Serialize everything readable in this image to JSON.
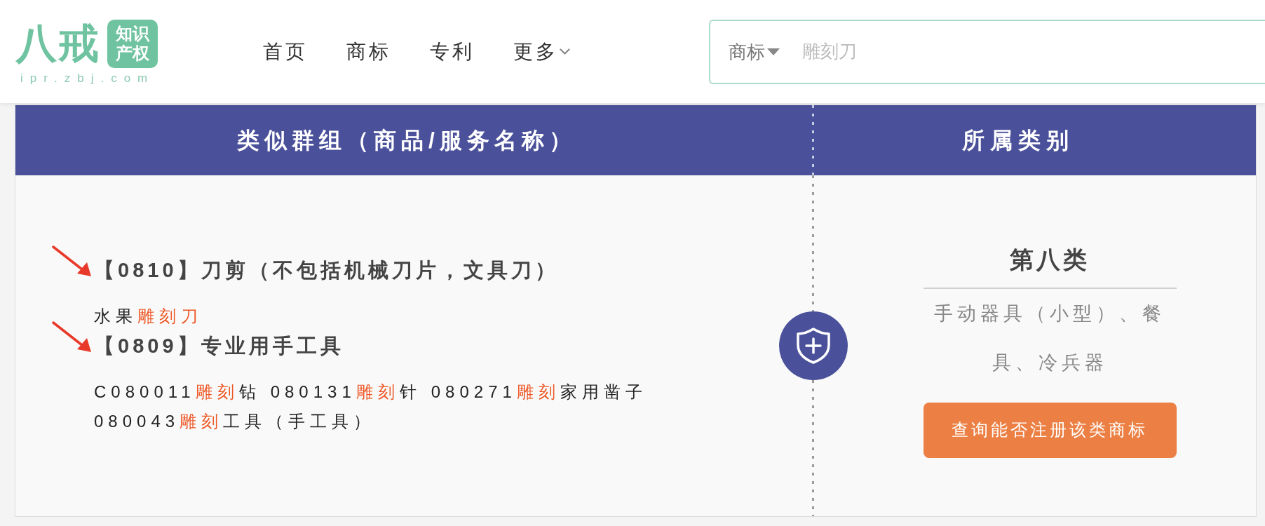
{
  "header": {
    "logo": {
      "name": "八戒",
      "badge": "知识产权",
      "domain": "ipr.zbj.com"
    },
    "nav": [
      {
        "label": "首页",
        "kind": "link"
      },
      {
        "label": "商标",
        "kind": "link"
      },
      {
        "label": "专利",
        "kind": "link"
      },
      {
        "label": "更多",
        "kind": "dropdown"
      }
    ],
    "search": {
      "category": "商标",
      "placeholder": "雕刻刀"
    }
  },
  "table": {
    "columns": [
      "类似群组（商品/服务名称）",
      "所属类别"
    ],
    "groups": [
      {
        "title": "【0810】刀剪（不包括机械刀片，文具刀）",
        "annotated": true,
        "items": [
          {
            "parts": [
              {
                "text": "水果",
                "highlight": false
              },
              {
                "text": "雕刻刀",
                "highlight": true
              }
            ]
          }
        ]
      },
      {
        "title": "【0809】专业用手工具",
        "annotated": true,
        "items": [
          {
            "parts": [
              {
                "text": "C080011",
                "highlight": false
              },
              {
                "text": "雕刻",
                "highlight": true
              },
              {
                "text": "钻",
                "highlight": false
              }
            ]
          },
          {
            "parts": [
              {
                "text": "080131",
                "highlight": false
              },
              {
                "text": "雕刻",
                "highlight": true
              },
              {
                "text": "针",
                "highlight": false
              }
            ]
          },
          {
            "parts": [
              {
                "text": "080271",
                "highlight": false
              },
              {
                "text": "雕刻",
                "highlight": true
              },
              {
                "text": "家用凿子",
                "highlight": false
              }
            ]
          },
          {
            "parts": [
              {
                "text": "080043",
                "highlight": false
              },
              {
                "text": "雕刻",
                "highlight": true
              },
              {
                "text": "工具（手工具）",
                "highlight": false
              }
            ]
          }
        ]
      }
    ],
    "category": {
      "title": "第八类",
      "description": "手动器具（小型）、餐具、冷兵器",
      "button": "查询能否注册该类商标"
    }
  }
}
